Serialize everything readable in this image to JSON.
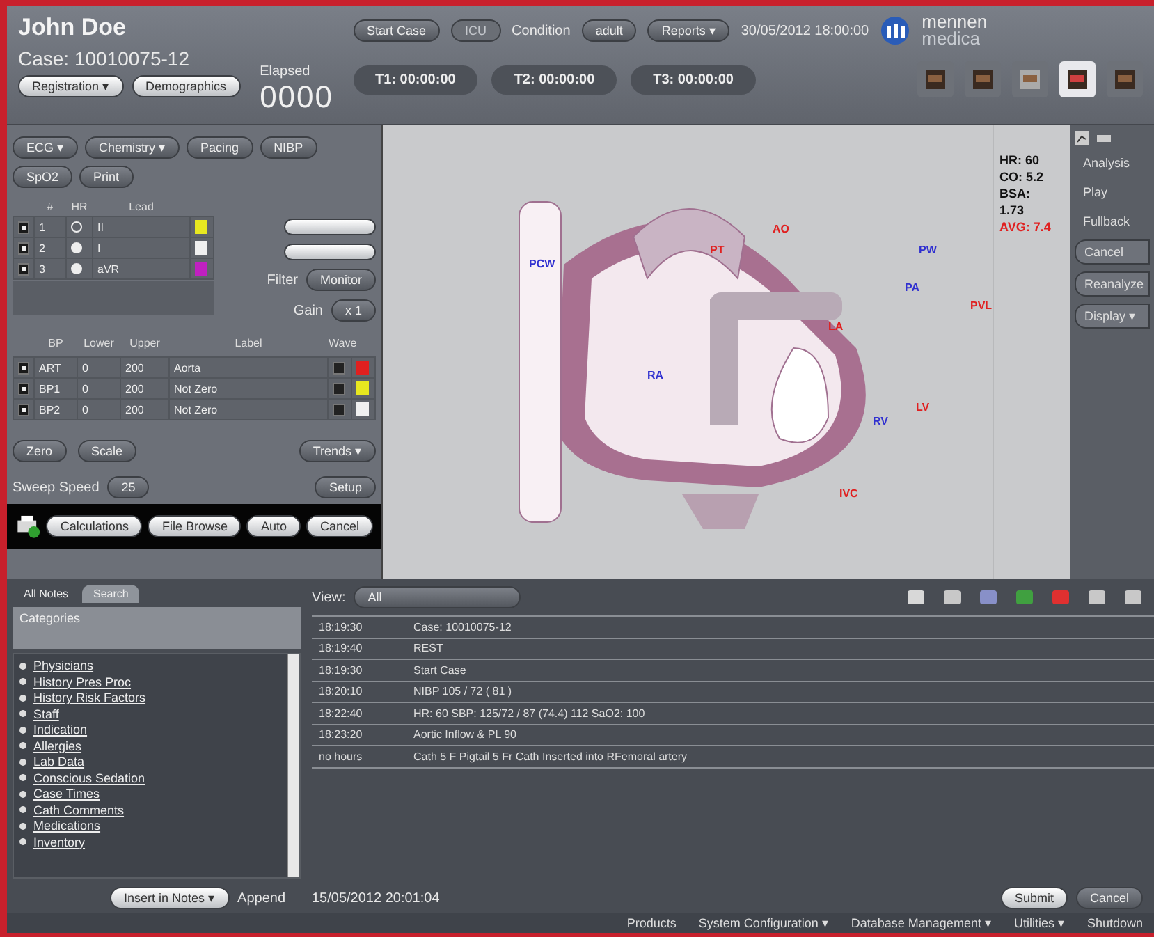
{
  "header": {
    "patient": "John Doe",
    "case": "Case: 10010075-12",
    "elapsed_label": "Elapsed",
    "elapsed": "0000",
    "buttons": [
      {
        "label": "Registration ▾",
        "disabled": false
      },
      {
        "label": "Demographics",
        "disabled": false
      }
    ],
    "actions": [
      {
        "label": "Start Case",
        "disabled": false
      },
      {
        "label": "ICU",
        "disabled": true
      }
    ],
    "condition_label": "Condition",
    "condition": "adult",
    "reports": "Reports ▾",
    "datetime": "30/05/2012 18:00:00",
    "logo": [
      "mennen",
      "medica"
    ],
    "timers": [
      "T1: 00:00:00",
      "T2: 00:00:00",
      "T3: 00:00:00"
    ],
    "views": [
      {
        "selected": false
      },
      {
        "selected": false
      },
      {
        "selected": false
      },
      {
        "selected": true
      },
      {
        "selected": false
      }
    ]
  },
  "controls": {
    "buttons": [
      "ECG ▾",
      "Chemistry ▾",
      "Pacing",
      "NIBP",
      "SpO2",
      "Print"
    ],
    "ecg_columns": [
      "#",
      "HR",
      "Lead"
    ],
    "ecg_rows": [
      {
        "checked": true,
        "num": "1",
        "hr": false,
        "lead": "II",
        "color": "#e8e820"
      },
      {
        "checked": true,
        "num": "2",
        "hr": true,
        "lead": "I",
        "color": "#f0f0f0"
      },
      {
        "checked": true,
        "num": "3",
        "hr": true,
        "lead": "aVR",
        "color": "#c020c0"
      }
    ],
    "filter_label": "Filter",
    "filter": "Monitor",
    "gain_label": "Gain",
    "gain": "x 1",
    "bp_columns": [
      "BP",
      "Lower",
      "Upper",
      "Label",
      "Wave"
    ],
    "bp_rows": [
      {
        "checked": true,
        "name": "ART",
        "lower": "0",
        "upper": "200",
        "label": "Aorta",
        "color": "#e02020"
      },
      {
        "checked": true,
        "name": "BP1",
        "lower": "0",
        "upper": "200",
        "label": "Not Zero",
        "color": "#e8e820"
      },
      {
        "checked": true,
        "name": "BP2",
        "lower": "0",
        "upper": "200",
        "label": "Not Zero",
        "color": "#f0f0f0"
      }
    ],
    "zero": "Zero",
    "scale": "Scale",
    "trends": "Trends ▾",
    "sweep_label": "Sweep Speed",
    "sweep": "25",
    "setup": "Setup",
    "bottom": [
      "Calculations",
      "File Browse",
      "Auto",
      "Cancel"
    ]
  },
  "diagram": {
    "labels": [
      {
        "text": "PCW",
        "color": "#3030d0"
      },
      {
        "text": "AO",
        "color": "#e02020"
      },
      {
        "text": "PT",
        "color": "#e02020"
      },
      {
        "text": "PA",
        "color": "#3030d0"
      },
      {
        "text": "PW",
        "color": "#3030d0"
      },
      {
        "text": "PVL",
        "color": "#e02020"
      },
      {
        "text": "LA",
        "color": "#e02020"
      },
      {
        "text": "RA",
        "color": "#3030d0"
      },
      {
        "text": "RV",
        "color": "#3030d0"
      },
      {
        "text": "LV",
        "color": "#e02020"
      },
      {
        "text": "IVC",
        "color": "#e02020"
      }
    ],
    "vitals": [
      {
        "text": "HR: 60",
        "alert": false
      },
      {
        "text": "CO: 5.2",
        "alert": false
      },
      {
        "text": "BSA:",
        "alert": false
      },
      {
        "text": "1.73",
        "alert": false
      },
      {
        "text": "AVG: 7.4",
        "alert": true
      }
    ]
  },
  "sidebar": {
    "items": [
      {
        "label": "Analysis",
        "kind": "flat"
      },
      {
        "label": "Play",
        "kind": "flat"
      },
      {
        "label": "Fullback",
        "kind": "flat"
      },
      {
        "label": "Cancel",
        "kind": "button"
      },
      {
        "label": "Reanalyze",
        "kind": "button"
      },
      {
        "label": "Display ▾",
        "kind": "button"
      }
    ]
  },
  "notes": {
    "tabs": [
      {
        "label": "All Notes",
        "selected": false
      },
      {
        "label": "Search",
        "selected": true
      }
    ],
    "categories_title": "Categories",
    "categories": [
      "Physicians",
      "History Pres Proc",
      "History Risk Factors",
      "Staff",
      "Indication",
      "Allergies",
      "Lab Data",
      "Conscious Sedation",
      "Case Times",
      "Cath Comments",
      "Medications",
      "Inventory"
    ],
    "view_label": "View:",
    "view": "All",
    "log": [
      {
        "time": "18:19:30",
        "text": "Case: 10010075-12"
      },
      {
        "time": "18:19:40",
        "text": "REST"
      },
      {
        "time": "18:19:30",
        "text": "Start Case"
      },
      {
        "time": "18:20:10",
        "text": "NIBP 105 / 72 ( 81 )"
      },
      {
        "time": "18:22:40",
        "text": "HR: 60 SBP: 125/72 / 87 (74.4) 112 SaO2: 100"
      },
      {
        "time": "18:23:20",
        "text": "Aortic Inflow & PL 90"
      },
      {
        "time": "no hours",
        "text": "Cath 5 F Pigtail 5 Fr Cath Inserted into RFemoral artery"
      }
    ],
    "insert": "Insert in Notes ▾",
    "append": "Append",
    "stamp": "15/05/2012 20:01:04",
    "submit": "Submit",
    "cancel": "Cancel"
  },
  "menu": [
    "Products",
    "System Configuration ▾",
    "Database Management ▾",
    "Utilities ▾",
    "Shutdown"
  ]
}
